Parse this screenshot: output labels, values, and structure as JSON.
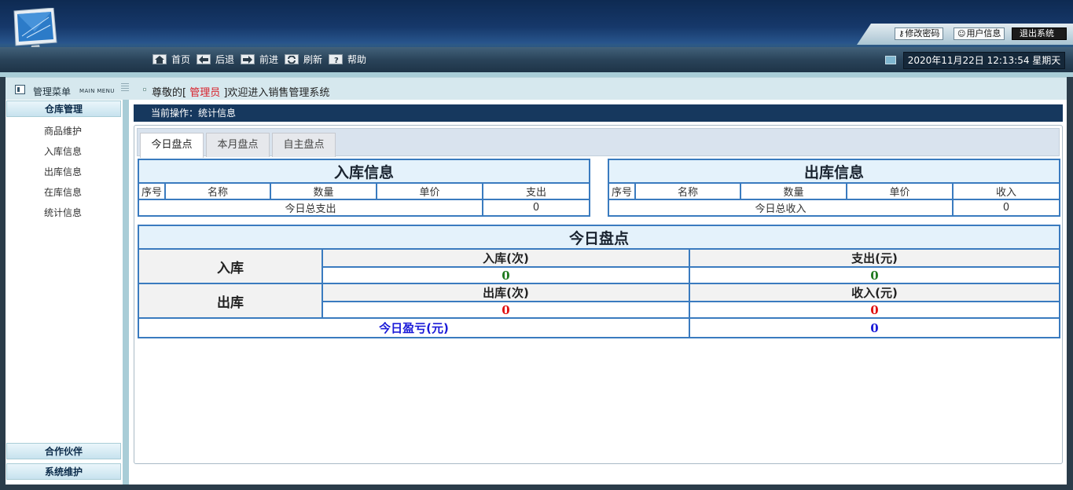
{
  "header": {
    "buttons": {
      "change_password": "修改密码",
      "user_info": "用户信息",
      "logout": "退出系统"
    },
    "nav": [
      {
        "label": "首页",
        "icon": "home-icon"
      },
      {
        "label": "后退",
        "icon": "back-arrow-icon"
      },
      {
        "label": "前进",
        "icon": "forward-arrow-icon"
      },
      {
        "label": "刷新",
        "icon": "refresh-icon"
      },
      {
        "label": "帮助",
        "icon": "help-icon"
      }
    ],
    "datetime": "2020年11月22日 12:13:54 星期天"
  },
  "menu_header": {
    "title": "管理菜单",
    "subtitle": "MAIN MENU"
  },
  "welcome": {
    "prefix": "尊敬的[",
    "role": " 管理员 ",
    "suffix": "]欢迎进入销售管理系统"
  },
  "sidebar": {
    "group_warehouse": "仓库管理",
    "items": [
      "商品维护",
      "入库信息",
      "出库信息",
      "在库信息",
      "统计信息"
    ],
    "group_partner": "合作伙伴",
    "group_system": "系统维护"
  },
  "breadcrumb": "当前操作：统计信息",
  "tabs": [
    "今日盘点",
    "本月盘点",
    "自主盘点"
  ],
  "inbound": {
    "title": "入库信息",
    "columns": [
      "序号",
      "名称",
      "数量",
      "单价",
      "支出"
    ],
    "total_label": "今日总支出",
    "total_value": "0"
  },
  "outbound": {
    "title": "出库信息",
    "columns": [
      "序号",
      "名称",
      "数量",
      "单价",
      "收入"
    ],
    "total_label": "今日总收入",
    "total_value": "0"
  },
  "summary": {
    "title": "今日盘点",
    "in_label": "入库",
    "in_count_label": "入库(次)",
    "in_count": "0",
    "expense_label": "支出(元)",
    "expense": "0",
    "out_label": "出库",
    "out_count_label": "出库(次)",
    "out_count": "0",
    "income_label": "收入(元)",
    "income": "0",
    "profit_label": "今日盈亏(元)",
    "profit": "0"
  },
  "colors": {
    "in_value": "#1f7a1f",
    "out_value": "#e01010",
    "profit": "#1a1ad8",
    "accent": "#16385e"
  }
}
